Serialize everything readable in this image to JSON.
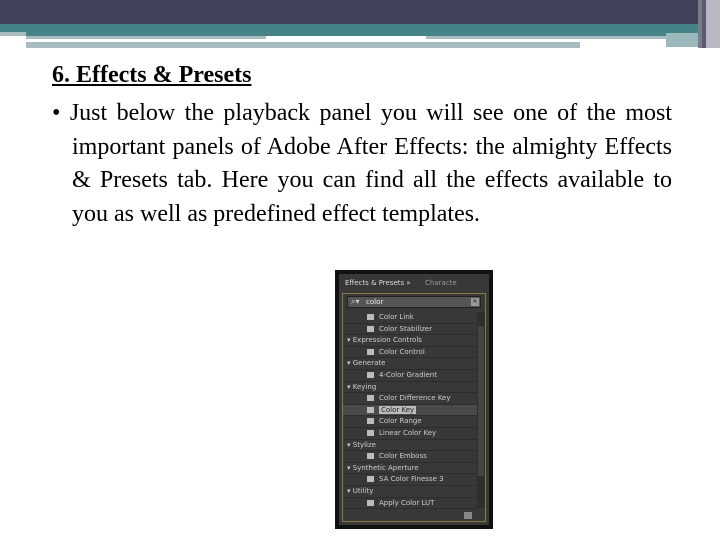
{
  "slide": {
    "title": "6. Effects & Presets",
    "bullet": "• Just below the playback panel you will see one of the most important panels of Adobe After Effects: the almighty Effects & Presets tab. Here you can find all the effects available to you as well as predefined effect templates."
  },
  "panel": {
    "tabs": [
      "Effects & Presets »",
      "Characte"
    ],
    "search_value": "color",
    "rows": [
      {
        "type": "effect",
        "label": "Color Link"
      },
      {
        "type": "effect",
        "label": "Color Stabilizer"
      },
      {
        "type": "category",
        "label": "Expression Controls"
      },
      {
        "type": "effect",
        "label": "Color Control"
      },
      {
        "type": "category",
        "label": "Generate"
      },
      {
        "type": "effect",
        "label": "4-Color Gradient"
      },
      {
        "type": "category",
        "label": "Keying"
      },
      {
        "type": "effect",
        "label": "Color Difference Key"
      },
      {
        "type": "effect",
        "label": "Color Key",
        "selected": true
      },
      {
        "type": "effect",
        "label": "Color Range"
      },
      {
        "type": "effect",
        "label": "Linear Color Key"
      },
      {
        "type": "category",
        "label": "Stylize"
      },
      {
        "type": "effect",
        "label": "Color Emboss"
      },
      {
        "type": "category",
        "label": "Synthetic Aperture"
      },
      {
        "type": "effect",
        "label": "SA Color Finesse 3"
      },
      {
        "type": "category",
        "label": "Utility"
      },
      {
        "type": "effect",
        "label": "Apply Color LUT"
      }
    ]
  },
  "colors": {
    "header": "#42435a",
    "accent": "#458386",
    "panel": "#383838"
  }
}
